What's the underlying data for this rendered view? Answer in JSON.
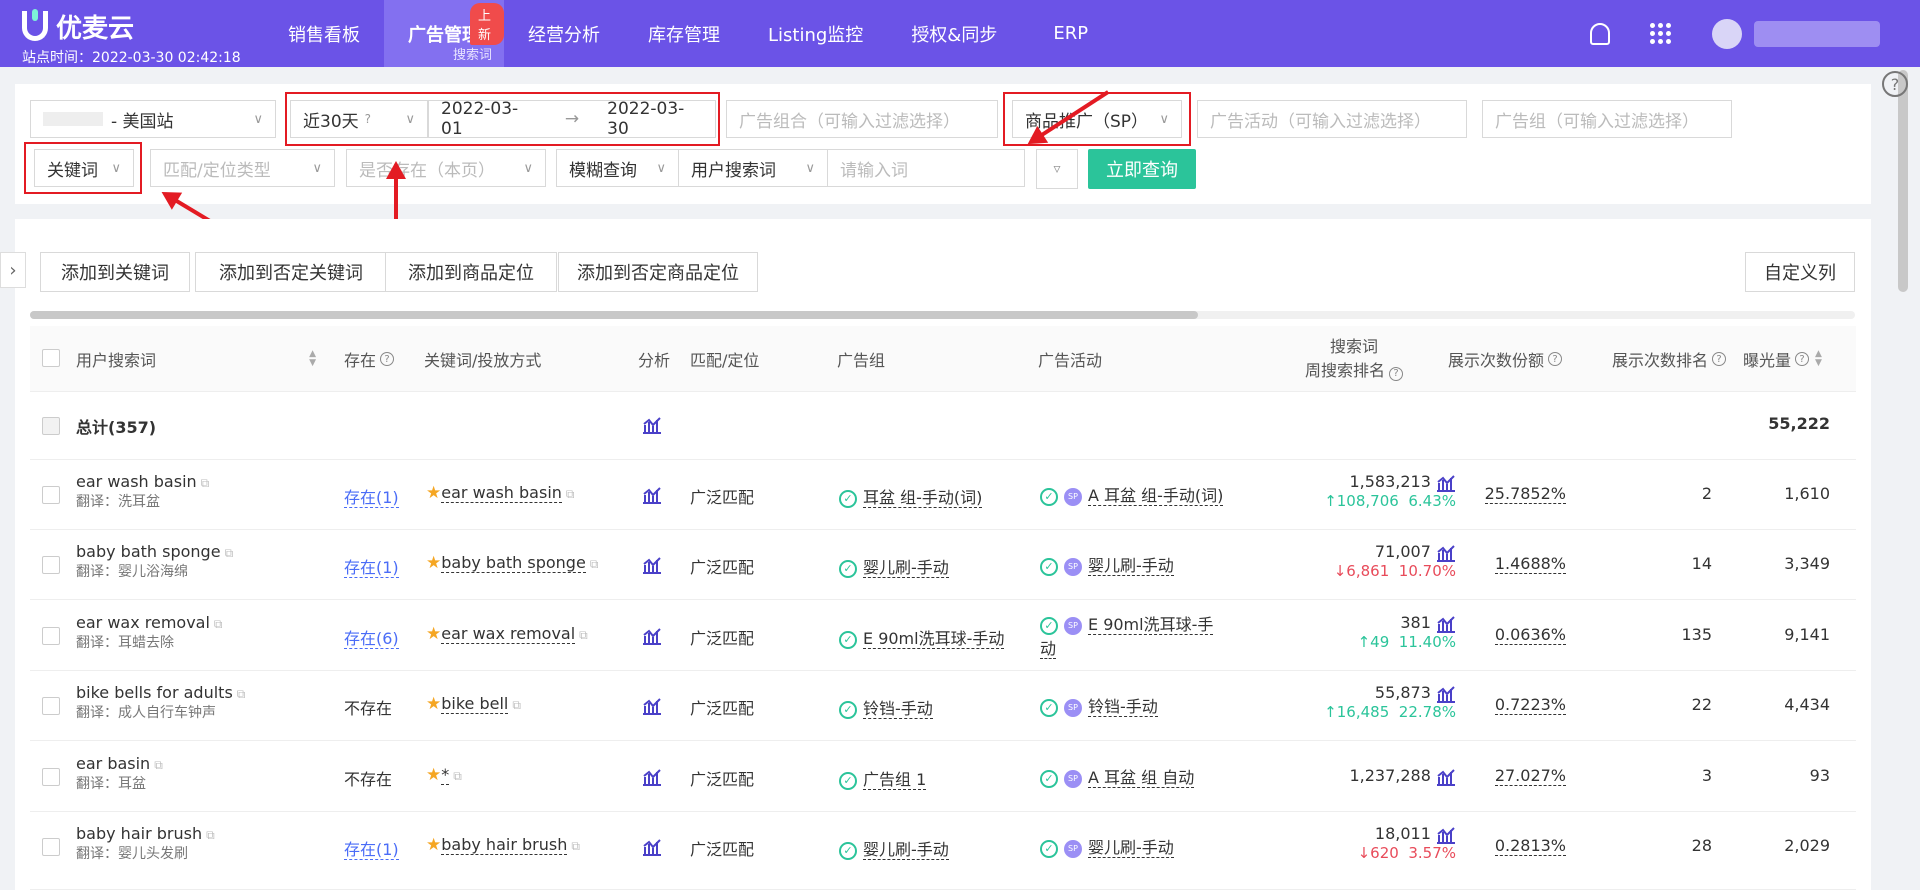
{
  "header": {
    "brand": "优麦云",
    "site_time": "站点时间：2022-03-30 02:42:18",
    "nav": [
      {
        "label": "销售看板"
      },
      {
        "label": "广告管理",
        "badge": "上新",
        "sub": "搜索词"
      },
      {
        "label": "经营分析"
      },
      {
        "label": "库存管理"
      },
      {
        "label": "Listing监控"
      },
      {
        "label": "授权&同步"
      },
      {
        "label": "ERP"
      }
    ]
  },
  "filters": {
    "store": "- 美国站",
    "period": "近30天",
    "date_start": "2022-03-01",
    "date_end": "2022-03-30",
    "ad_portfolio_ph": "广告组合（可输入过滤选择）",
    "ad_type": "商品推广（SP）",
    "campaign_ph": "广告活动（可输入过滤选择）",
    "ad_group_ph": "广告组（可输入过滤选择）",
    "keyword_type": "关键词",
    "match_type_ph": "匹配/定位类型",
    "exists_ph": "是否存在（本页）",
    "fuzzy": "模糊查询",
    "search_field": "用户搜索词",
    "search_ph": "请输入词",
    "submit": "立即查询"
  },
  "actions": {
    "add_keyword": "添加到关键词",
    "add_negative_keyword": "添加到否定关键词",
    "add_product_target": "添加到商品定位",
    "add_negative_product_target": "添加到否定商品定位",
    "custom_columns": "自定义列"
  },
  "table": {
    "columns": {
      "search_term": "用户搜索词",
      "exists": "存在",
      "keyword": "关键词/投放方式",
      "analysis": "分析",
      "match": "匹配/定位",
      "ad_group": "广告组",
      "campaign": "广告活动",
      "rank_line1": "搜索词",
      "rank_line2": "周搜索排名",
      "share": "展示次数份额",
      "share_rank": "展示次数排名",
      "impressions": "曝光量"
    },
    "total": {
      "label": "总计(357)",
      "impressions": "55,222"
    },
    "rows": [
      {
        "term": "ear wash basin",
        "translation": "翻译：洗耳盆",
        "exists": "存在(1)",
        "keyword": "ear wash basin",
        "match": "广泛匹配",
        "ad_group": "耳盆 组-手动(词)",
        "campaign": "A 耳盆 组-手动(词)",
        "rank": "1,583,213",
        "delta": "108,706",
        "pct": "6.43%",
        "dir": "up",
        "share": "25.7852%",
        "share_rank": "2",
        "impressions": "1,610"
      },
      {
        "term": "baby bath sponge",
        "translation": "翻译：婴儿浴海绵",
        "exists": "存在(1)",
        "keyword": "baby bath sponge",
        "match": "广泛匹配",
        "ad_group": "婴儿刷-手动",
        "campaign": "婴儿刷-手动",
        "rank": "71,007",
        "delta": "6,861",
        "pct": "10.70%",
        "dir": "down",
        "share": "1.4688%",
        "share_rank": "14",
        "impressions": "3,349"
      },
      {
        "term": "ear wax removal",
        "translation": "翻译：耳蜡去除",
        "exists": "存在(6)",
        "keyword": "ear wax removal",
        "match": "广泛匹配",
        "ad_group": "E 90ml洗耳球-手动",
        "campaign": "E 90ml洗耳球-手",
        "campaign2": "动",
        "rank": "381",
        "delta": "49",
        "pct": "11.40%",
        "dir": "up",
        "share": "0.0636%",
        "share_rank": "135",
        "impressions": "9,141"
      },
      {
        "term": "bike bells for adults",
        "translation": "翻译：成人自行车钟声",
        "exists": "不存在",
        "keyword": "bike bell",
        "match": "广泛匹配",
        "ad_group": "铃铛-手动",
        "campaign": "铃铛-手动",
        "rank": "55,873",
        "delta": "16,485",
        "pct": "22.78%",
        "dir": "up",
        "share": "0.7223%",
        "share_rank": "22",
        "impressions": "4,434"
      },
      {
        "term": "ear basin",
        "translation": "翻译：耳盆",
        "exists": "不存在",
        "keyword": "*",
        "match": "广泛匹配",
        "ad_group": "广告组 1",
        "campaign": "A 耳盆 组 自动",
        "rank": "1,237,288",
        "delta": "",
        "pct": "",
        "dir": "",
        "share": "27.027%",
        "share_rank": "3",
        "impressions": "93"
      },
      {
        "term": "baby hair brush",
        "translation": "翻译：婴儿头发刷",
        "exists": "存在(1)",
        "keyword": "baby hair brush",
        "match": "广泛匹配",
        "ad_group": "婴儿刷-手动",
        "campaign": "婴儿刷-手动",
        "rank": "18,011",
        "delta": "620",
        "pct": "3.57%",
        "dir": "down",
        "share": "0.2813%",
        "share_rank": "28",
        "impressions": "2,029"
      }
    ]
  },
  "colors": {
    "brand": "#6b53e7",
    "accent": "#2bc49a",
    "annotation": "#e31b23",
    "link": "#4a6cf7"
  }
}
